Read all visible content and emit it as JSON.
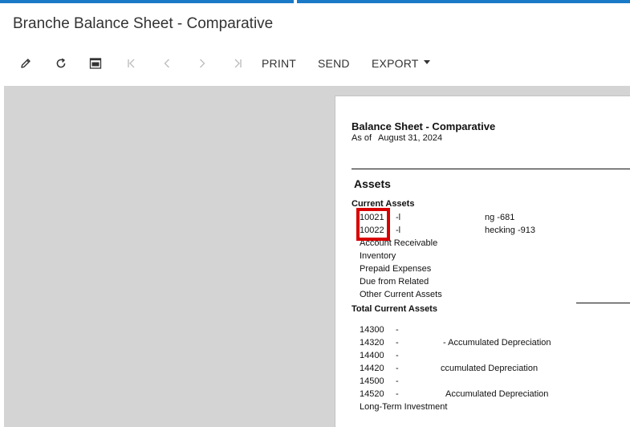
{
  "screen": {
    "title": "Branche Balance Sheet - Comparative"
  },
  "toolbar": {
    "icons": [
      "pencil-icon",
      "refresh-icon",
      "pdf-icon",
      "first-page-icon",
      "previous-page-icon",
      "next-page-icon",
      "last-page-icon"
    ],
    "print_label": "PRINT",
    "send_label": "SEND",
    "export_label": "EXPORT"
  },
  "colors": {
    "accent": "#1a7ac8",
    "viewer_bg": "#d4d4d4",
    "highlight": "#d80000",
    "disabled": "#bdbdbd"
  },
  "report": {
    "title": "Balance Sheet - Comparative",
    "as_of_label": "As of",
    "as_of_date": "August 31, 2024",
    "section_assets": "Assets",
    "current_assets_heading": "Current Assets",
    "current_accounts": [
      {
        "code": "10021",
        "dash": "-l",
        "name": "ng -681"
      },
      {
        "code": "10022",
        "dash": "-l",
        "name": "hecking -913"
      }
    ],
    "current_items": [
      "Account Receivable",
      "Inventory",
      "Prepaid Expenses",
      "Due from Related",
      "Other Current Assets"
    ],
    "total_current_assets": "Total Current Assets",
    "fixed_accounts": [
      {
        "code": "14300",
        "text": "-"
      },
      {
        "code": "14320",
        "text": "-",
        "name": "- Accumulated Depreciation"
      },
      {
        "code": "14400",
        "text": "-"
      },
      {
        "code": "14420",
        "text": "-",
        "name": "ccumulated Depreciation"
      },
      {
        "code": "14500",
        "text": "-"
      },
      {
        "code": "14520",
        "text": "-",
        "name": "Accumulated Depreciation"
      }
    ],
    "long_term_investment": "Long-Term Investment"
  }
}
